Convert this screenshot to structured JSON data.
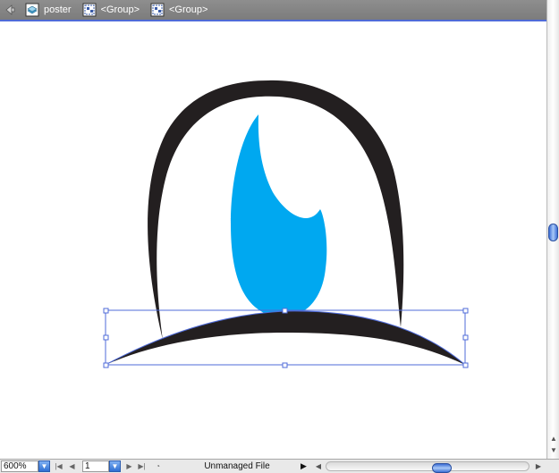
{
  "breadcrumb": {
    "items": [
      {
        "label": "poster",
        "icon": "layer-stack-icon"
      },
      {
        "label": "<Group>",
        "icon": "group-icon"
      },
      {
        "label": "<Group>",
        "icon": "group-icon"
      }
    ]
  },
  "artwork": {
    "colors": {
      "outline": "#231f20",
      "iris": "#00a8f0",
      "selection": "#4f6bd8"
    }
  },
  "statusbar": {
    "zoom": "600%",
    "page": "1",
    "status_text": "Unmanaged File"
  }
}
